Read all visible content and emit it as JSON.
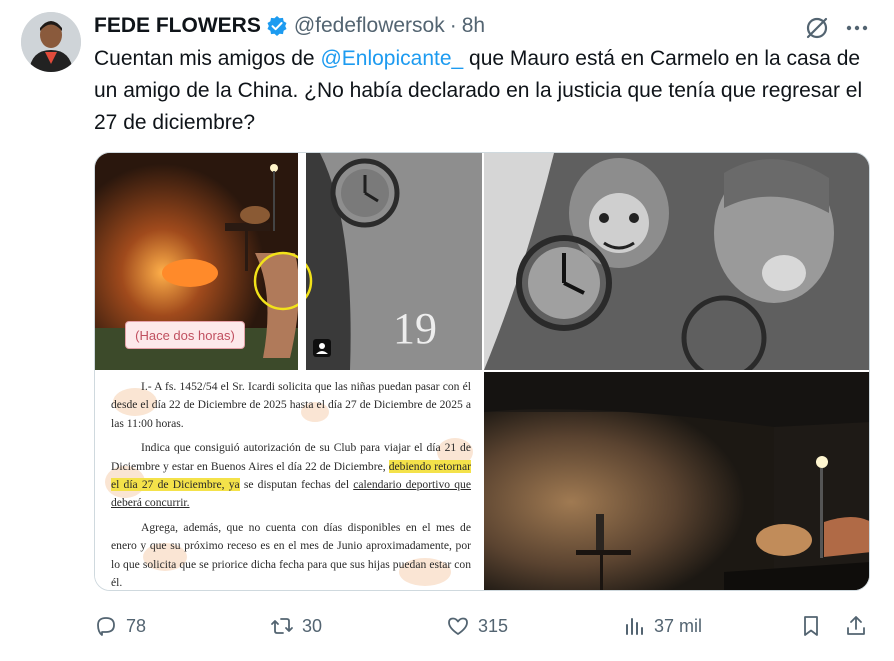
{
  "tweet": {
    "author_name": "FEDE FLOWERS",
    "handle": "@fedeflowersok",
    "separator": "·",
    "time": "8h",
    "text_before": "Cuentan mis amigos de ",
    "mention": "@Enlopicante_",
    "text_after": " que Mauro está en Carmelo en la casa de un amigo de la China. ¿No había declarado en la justicia que tenía que regresar el 27 de diciembre?",
    "verified_color": "#1d9bf0"
  },
  "media": {
    "photo1_caption": "(Hace dos horas)",
    "document": {
      "p1": "I.- A fs. 1452/54 el Sr. Icardi solicita que las niñas puedan pasar con él desde el día 22 de Diciembre de 2025 hasta el día 27 de Diciembre de 2025 a las 11:00 horas.",
      "p2_a": "Indica que consiguió autorización de su Club para viajar el día 21 de Diciembre y estar en Buenos Aires el día 22 de Diciembre, ",
      "p2_hl": "debiendo retornar el día 27 de Diciembre, ya",
      "p2_b": " se disputan fechas del ",
      "p2_ul": "calendario deportivo que deberá concurrir.",
      "p3": "Agrega, además, que no cuenta con días disponibles en el mes de enero y que su próximo receso es en el mes de Junio aproximadamente, por lo que solicita que se priorice dicha fecha para que sus hijas puedan estar con él."
    },
    "tattoo_number": "19"
  },
  "actions": {
    "replies": "78",
    "reposts": "30",
    "likes": "315",
    "views": "37 mil"
  },
  "icons": {
    "reply": "reply-icon",
    "repost": "repost-icon",
    "like": "heart-icon",
    "views": "views-icon",
    "bookmark": "bookmark-icon",
    "share": "share-icon",
    "grok": "grok-icon",
    "more": "more-icon",
    "verified": "verified-badge-icon"
  }
}
